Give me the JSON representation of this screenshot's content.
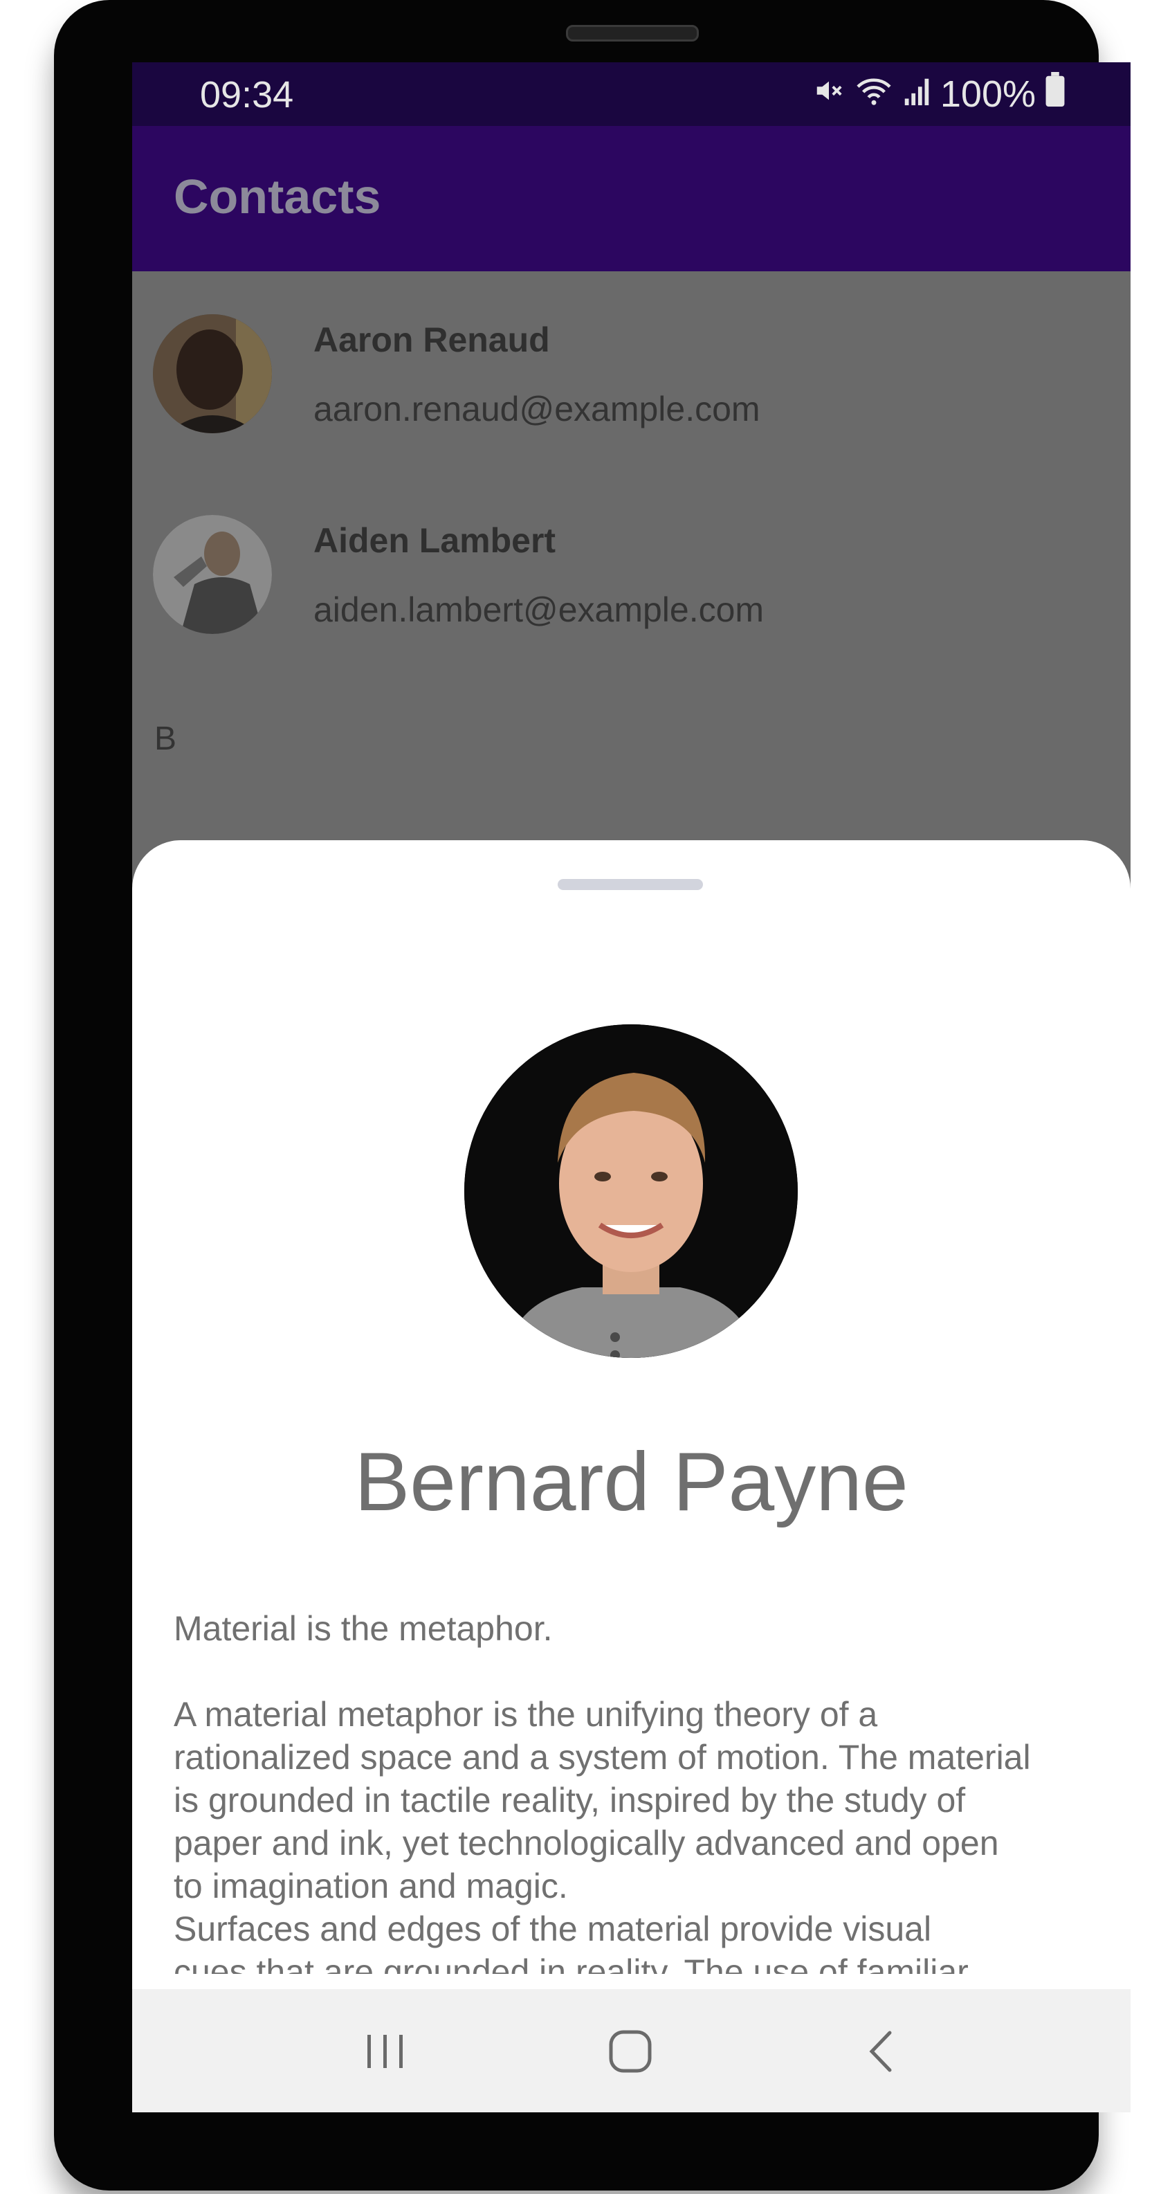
{
  "status_bar": {
    "time": "09:34",
    "battery": "100%",
    "icons": [
      "mute-icon",
      "wifi-icon",
      "signal-icon",
      "battery-icon"
    ]
  },
  "app_bar": {
    "title": "Contacts"
  },
  "contacts": [
    {
      "name": "Aaron Renaud",
      "email": "aaron.renaud@example.com"
    },
    {
      "name": "Aiden Lambert",
      "email": "aiden.lambert@example.com"
    }
  ],
  "section_letter": "B",
  "detail_sheet": {
    "name": "Bernard Payne",
    "bio_paragraphs": [
      "Material is the metaphor.",
      " A material metaphor is the unifying theory of a\nrationalized space and a system of motion. The material\nis grounded in tactile reality, inspired by the study of\npaper and ink, yet  technologically advanced and open\nto imagination and magic.\n Surfaces and edges of the material provide visual\ncues that are grounded in reality. The  use of familiar"
    ]
  },
  "nav_bar": {
    "icons": [
      "recents-icon",
      "home-icon",
      "back-icon"
    ]
  },
  "colors": {
    "status_bar": "#1a0640",
    "app_bar": "#2c0660",
    "scrim": "#6a6a6a",
    "sheet": "#ffffff"
  }
}
